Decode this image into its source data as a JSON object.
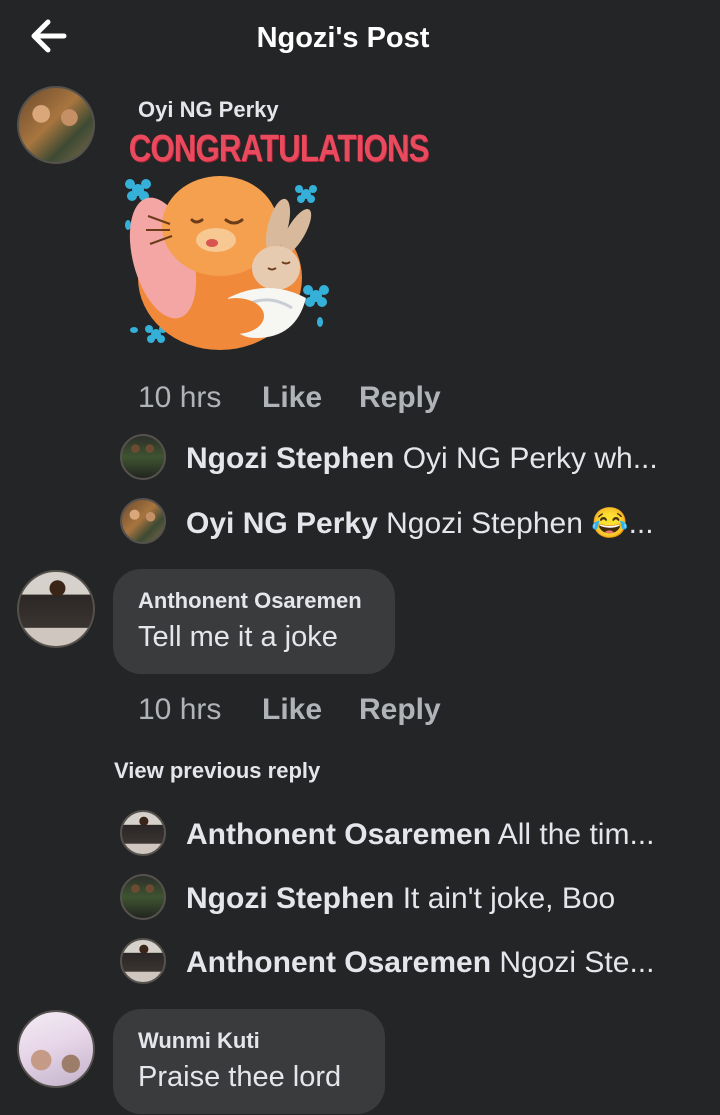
{
  "header": {
    "title": "Ngozi's Post"
  },
  "comments": [
    {
      "author": "Oyi NG Perky",
      "sticker_text": "CONGRATULATIONS",
      "time": "10 hrs",
      "like_label": "Like",
      "reply_label": "Reply",
      "replies": [
        {
          "author": "Ngozi Stephen",
          "text": "Oyi NG Perky wh..."
        },
        {
          "author": "Oyi NG Perky",
          "text": "Ngozi Stephen 😂..."
        }
      ]
    },
    {
      "author": "Anthonent Osaremen",
      "text": "Tell me it a joke",
      "time": "10 hrs",
      "like_label": "Like",
      "reply_label": "Reply",
      "view_previous_label": "View previous reply",
      "replies": [
        {
          "author": "Anthonent Osaremen",
          "text": "All the tim..."
        },
        {
          "author": "Ngozi Stephen",
          "text": "It ain't joke, Boo"
        },
        {
          "author": "Anthonent Osaremen",
          "text": "Ngozi Ste..."
        }
      ]
    },
    {
      "author": "Wunmi Kuti",
      "text": "Praise thee lord"
    }
  ],
  "icons": {
    "back": "arrow-left-icon",
    "sticker": "congratulations-bunny-sticker"
  },
  "colors": {
    "background": "#242526",
    "bubble": "#3a3b3c",
    "text": "#e4e6eb",
    "muted": "#b0b3b8",
    "sticker_title": "#ea4a5d"
  }
}
